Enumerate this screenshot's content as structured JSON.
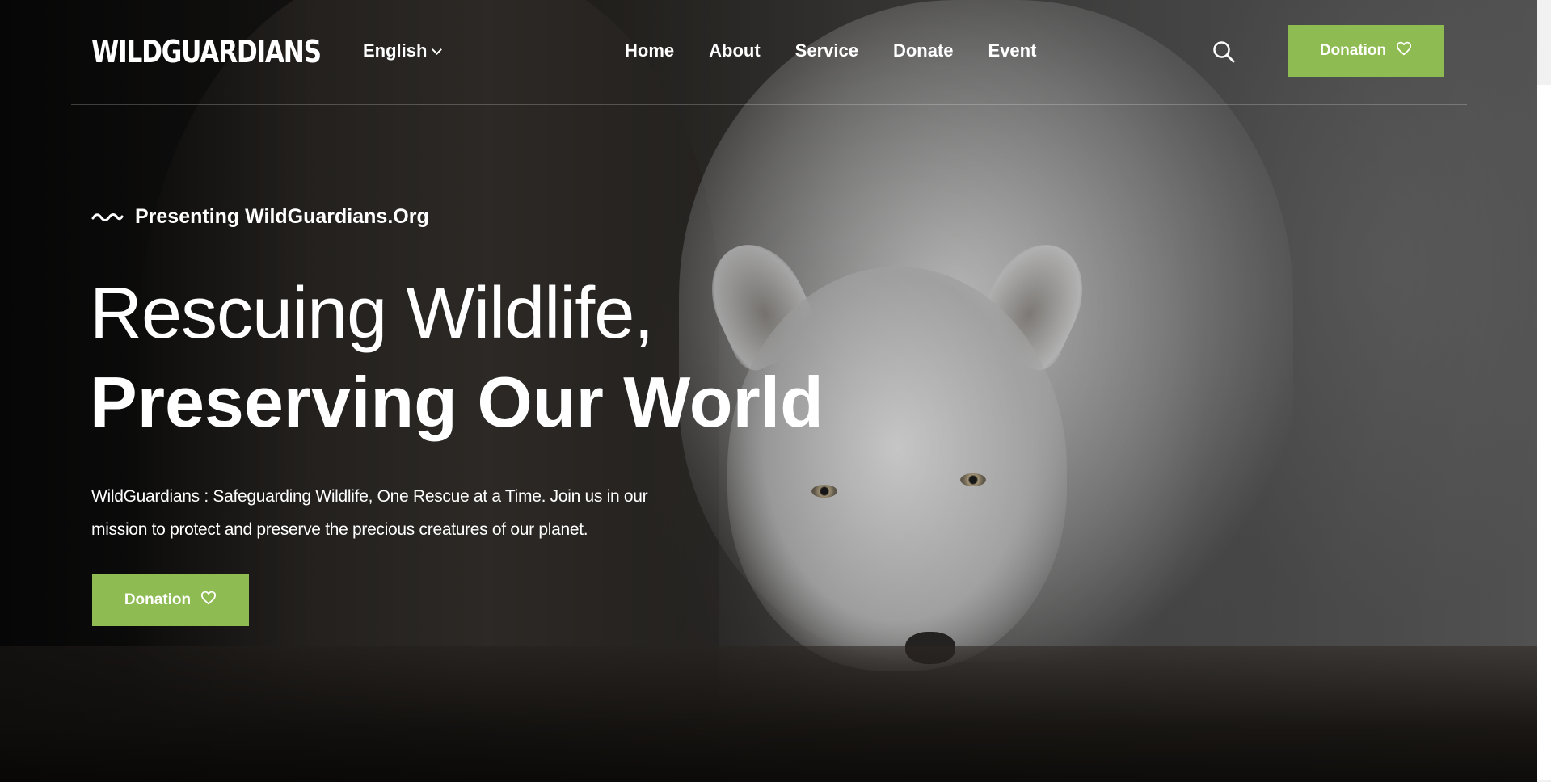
{
  "header": {
    "logo": "WILDGUARDIANS",
    "language": "English",
    "nav": [
      {
        "label": "Home"
      },
      {
        "label": "About"
      },
      {
        "label": "Service"
      },
      {
        "label": "Donate"
      },
      {
        "label": "Event"
      }
    ],
    "search_icon": "search-icon",
    "donate_button": {
      "label": "Donation",
      "icon": "heart-icon"
    }
  },
  "hero": {
    "eyebrow": "Presenting WildGuardians.Org",
    "eyebrow_icon": "wave-icon",
    "title_line1": "Rescuing Wildlife,",
    "title_line2": "Preserving Our World",
    "description": "WildGuardians : Safeguarding Wildlife, One Rescue at a Time. Join us in our mission to protect and preserve the precious creatures of our planet.",
    "cta": {
      "label": "Donation",
      "icon": "heart-icon"
    }
  },
  "colors": {
    "accent": "#8fbb53",
    "text": "#ffffff"
  }
}
